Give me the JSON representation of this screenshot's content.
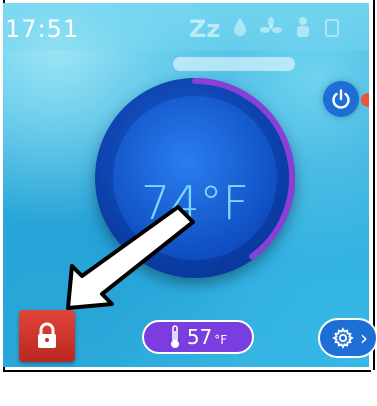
{
  "status_bar": {
    "time": "17:51",
    "sleep_label": "Zz",
    "icons": [
      "sleep-icon",
      "water-drop-icon",
      "fan-icon",
      "person-icon",
      "battery-icon"
    ]
  },
  "thermostat": {
    "temperature": "74°F",
    "progress_fraction": 0.4,
    "accent_color": "#8a3fd8"
  },
  "outdoor": {
    "value": "57",
    "unit": "°F",
    "icon": "thermometer-icon"
  },
  "controls": {
    "power_icon": "power-icon",
    "lock_icon": "lock-icon",
    "settings_icon": "gear-icon",
    "settings_arrow": "›"
  },
  "colors": {
    "lock_red": "#c9302a",
    "button_blue": "#1d6fd6",
    "pill_purple": "#7a3de0",
    "dial_blue": "#0b3ea8"
  },
  "annotation": {
    "arrow": "arrow-icon"
  }
}
